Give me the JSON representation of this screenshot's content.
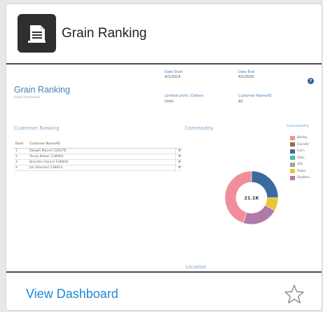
{
  "card": {
    "title": "Grain Ranking",
    "icon": "document-icon",
    "view_link": "View Dashboard",
    "favorite_icon": "star-icon"
  },
  "dashboard": {
    "title": "Grain Ranking",
    "subtitle": "Units Purchased",
    "filters": {
      "date_start_label": "Date Start",
      "date_start_value": "4/1/2019",
      "date_end_label": "Date End",
      "date_end_value": "4/1/2020",
      "limited_label": "Limited Units / Dollars",
      "limited_value": "Units",
      "customer_label": "Customer Name/ID",
      "customer_value": "All"
    },
    "help": "?",
    "sections": {
      "customer_ranking": "Customer Ranking",
      "commodity": "Commodity",
      "commodity_legend": "Commodity",
      "location": "Location"
    },
    "table": {
      "headers": [
        "Rank",
        "Customer Name/ID"
      ],
      "rows": [
        [
          "1",
          "Dwight Moore/ 226278"
        ],
        [
          "2",
          "Toney Baker/ 238964"
        ],
        [
          "3",
          "Brandon Henry/ 238840"
        ],
        [
          "4",
          "Jim Stanner/ 238814"
        ]
      ],
      "dropdown_glyph": "▼"
    },
    "legend": [
      {
        "label": "Barley",
        "color": "#f28e9b"
      },
      {
        "label": "CornOil",
        "color": "#9c6b3d"
      },
      {
        "label": "Corn",
        "color": "#3b6aa0"
      },
      {
        "label": "Oats",
        "color": "#59b8a8"
      },
      {
        "label": "Oils",
        "color": "#a1a1a1"
      },
      {
        "label": "Proto",
        "color": "#e9c536"
      },
      {
        "label": "Soybins",
        "color": "#b07aa6"
      }
    ],
    "donut_total": "21.1K"
  },
  "chart_data": {
    "type": "pie",
    "title": "Commodity",
    "center_label": "21.1K",
    "categories": [
      "Corn",
      "Proto",
      "Soybins",
      "Barley"
    ],
    "values": [
      0.25,
      0.08,
      0.22,
      0.45
    ],
    "colors": [
      "#3b6aa0",
      "#e9c536",
      "#b07aa6",
      "#f28e9b"
    ]
  }
}
